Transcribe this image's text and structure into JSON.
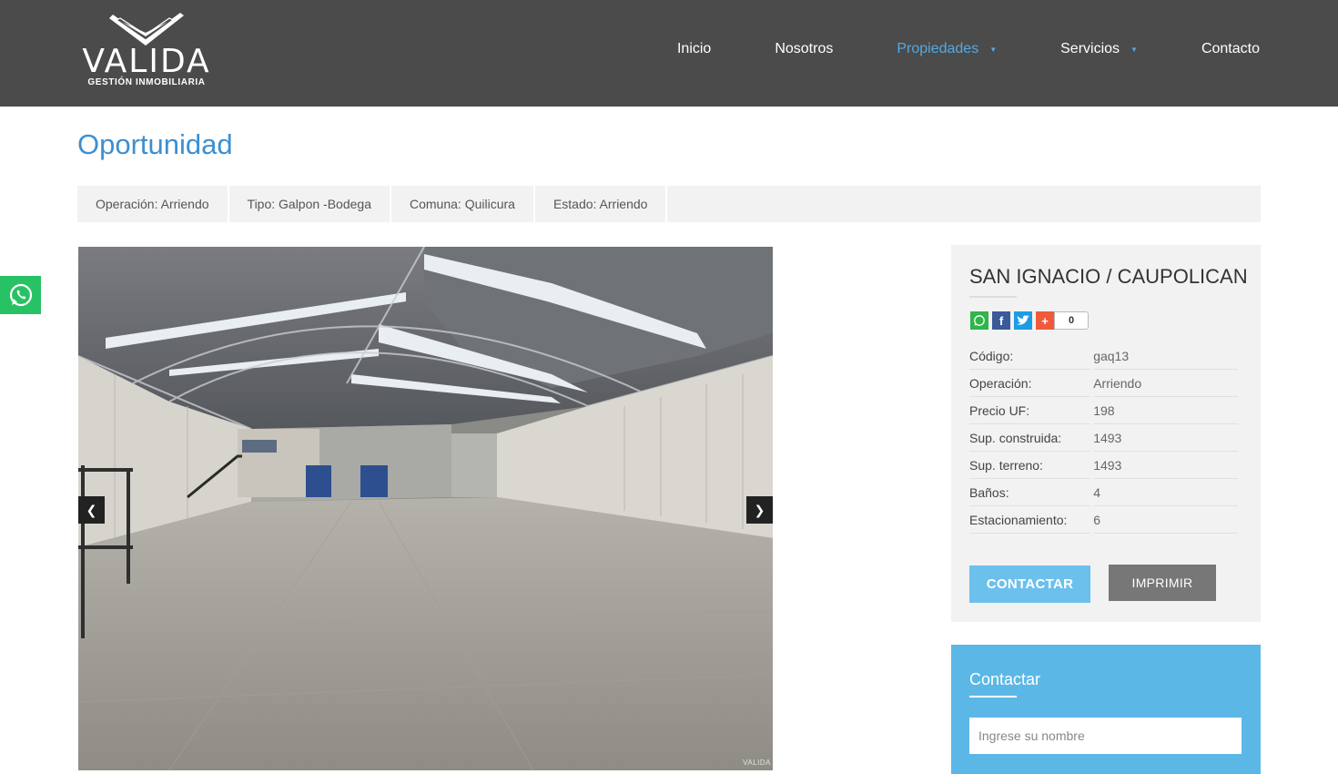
{
  "brand": {
    "name": "VALIDA",
    "tagline": "GESTIÓN INMOBILIARIA"
  },
  "nav": {
    "items": [
      {
        "label": "Inicio"
      },
      {
        "label": "Nosotros"
      },
      {
        "label": "Propiedades",
        "active": true,
        "dropdown": true
      },
      {
        "label": "Servicios",
        "dropdown": true
      },
      {
        "label": "Contacto"
      }
    ]
  },
  "page": {
    "title": "Oportunidad"
  },
  "info_bar": [
    "Operación: Arriendo",
    "Tipo: Galpon -Bodega",
    "Comuna: Quilicura",
    "Estado: Arriendo"
  ],
  "gallery": {
    "watermark": "VALIDA"
  },
  "property": {
    "name": "SAN IGNACIO / CAUPOLICAN",
    "share_count": "0",
    "details": [
      {
        "label": "Código:",
        "value": "gaq13"
      },
      {
        "label": "Operación:",
        "value": "Arriendo"
      },
      {
        "label": "Precio UF:",
        "value": "198"
      },
      {
        "label": "Sup. construida:",
        "value": "1493"
      },
      {
        "label": "Sup. terreno:",
        "value": "1493"
      },
      {
        "label": "Baños:",
        "value": "4"
      },
      {
        "label": "Estacionamiento:",
        "value": "6"
      }
    ],
    "contact_label": "CONTACTAR",
    "print_label": "IMPRIMIR"
  },
  "contact_form": {
    "title": "Contactar",
    "name_placeholder": "Ingrese su nombre"
  },
  "colors": {
    "header": "#4b4b4b",
    "accent": "#55a9e3",
    "title": "#3d8fd1",
    "contact_button": "#6cc0ec",
    "print_button": "#777777",
    "contact_box": "#5bb8e6",
    "whatsapp": "#27c264"
  }
}
